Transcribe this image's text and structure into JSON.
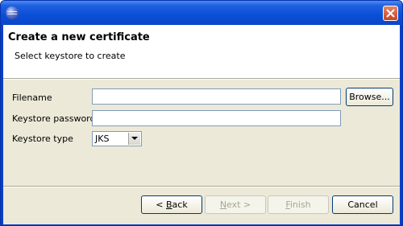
{
  "window": {
    "title_icon": "eclipse-app-icon",
    "close_icon": "close-icon"
  },
  "header": {
    "title": "Create a new certificate",
    "subtitle": "Select keystore to create"
  },
  "form": {
    "filename_label": "Filename",
    "filename_value": "",
    "browse_label": "Browse...",
    "password_label": "Keystore password",
    "password_value": "",
    "type_label": "Keystore type",
    "type_value": "JKS"
  },
  "buttons": {
    "back_label": "< Back",
    "back_mnemonic": "B",
    "next_label": "Next >",
    "next_mnemonic": "N",
    "finish_label": "Finish",
    "finish_mnemonic": "F",
    "cancel_label": "Cancel"
  }
}
